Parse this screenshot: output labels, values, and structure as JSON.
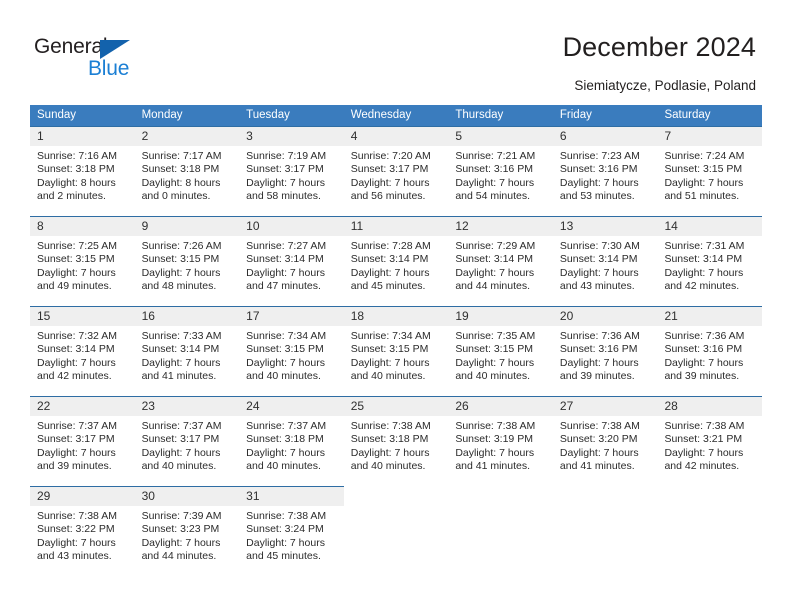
{
  "logo": {
    "word_top": "General",
    "word_bottom": "Blue",
    "triangle_color": "#1362ac",
    "blue_text_color": "#1b7fd4"
  },
  "header": {
    "title": "December 2024",
    "subtitle": "Siemiatycze, Podlasie, Poland"
  },
  "theme": {
    "header_blue": "#3a7cbe",
    "cell_top_border": "#2e6da4",
    "daynum_bg": "#efefef"
  },
  "weekdays": [
    "Sunday",
    "Monday",
    "Tuesday",
    "Wednesday",
    "Thursday",
    "Friday",
    "Saturday"
  ],
  "weeks": [
    [
      {
        "day": "1",
        "sunrise": "Sunrise: 7:16 AM",
        "sunset": "Sunset: 3:18 PM",
        "daylight1": "Daylight: 8 hours",
        "daylight2": "and 2 minutes."
      },
      {
        "day": "2",
        "sunrise": "Sunrise: 7:17 AM",
        "sunset": "Sunset: 3:18 PM",
        "daylight1": "Daylight: 8 hours",
        "daylight2": "and 0 minutes."
      },
      {
        "day": "3",
        "sunrise": "Sunrise: 7:19 AM",
        "sunset": "Sunset: 3:17 PM",
        "daylight1": "Daylight: 7 hours",
        "daylight2": "and 58 minutes."
      },
      {
        "day": "4",
        "sunrise": "Sunrise: 7:20 AM",
        "sunset": "Sunset: 3:17 PM",
        "daylight1": "Daylight: 7 hours",
        "daylight2": "and 56 minutes."
      },
      {
        "day": "5",
        "sunrise": "Sunrise: 7:21 AM",
        "sunset": "Sunset: 3:16 PM",
        "daylight1": "Daylight: 7 hours",
        "daylight2": "and 54 minutes."
      },
      {
        "day": "6",
        "sunrise": "Sunrise: 7:23 AM",
        "sunset": "Sunset: 3:16 PM",
        "daylight1": "Daylight: 7 hours",
        "daylight2": "and 53 minutes."
      },
      {
        "day": "7",
        "sunrise": "Sunrise: 7:24 AM",
        "sunset": "Sunset: 3:15 PM",
        "daylight1": "Daylight: 7 hours",
        "daylight2": "and 51 minutes."
      }
    ],
    [
      {
        "day": "8",
        "sunrise": "Sunrise: 7:25 AM",
        "sunset": "Sunset: 3:15 PM",
        "daylight1": "Daylight: 7 hours",
        "daylight2": "and 49 minutes."
      },
      {
        "day": "9",
        "sunrise": "Sunrise: 7:26 AM",
        "sunset": "Sunset: 3:15 PM",
        "daylight1": "Daylight: 7 hours",
        "daylight2": "and 48 minutes."
      },
      {
        "day": "10",
        "sunrise": "Sunrise: 7:27 AM",
        "sunset": "Sunset: 3:14 PM",
        "daylight1": "Daylight: 7 hours",
        "daylight2": "and 47 minutes."
      },
      {
        "day": "11",
        "sunrise": "Sunrise: 7:28 AM",
        "sunset": "Sunset: 3:14 PM",
        "daylight1": "Daylight: 7 hours",
        "daylight2": "and 45 minutes."
      },
      {
        "day": "12",
        "sunrise": "Sunrise: 7:29 AM",
        "sunset": "Sunset: 3:14 PM",
        "daylight1": "Daylight: 7 hours",
        "daylight2": "and 44 minutes."
      },
      {
        "day": "13",
        "sunrise": "Sunrise: 7:30 AM",
        "sunset": "Sunset: 3:14 PM",
        "daylight1": "Daylight: 7 hours",
        "daylight2": "and 43 minutes."
      },
      {
        "day": "14",
        "sunrise": "Sunrise: 7:31 AM",
        "sunset": "Sunset: 3:14 PM",
        "daylight1": "Daylight: 7 hours",
        "daylight2": "and 42 minutes."
      }
    ],
    [
      {
        "day": "15",
        "sunrise": "Sunrise: 7:32 AM",
        "sunset": "Sunset: 3:14 PM",
        "daylight1": "Daylight: 7 hours",
        "daylight2": "and 42 minutes."
      },
      {
        "day": "16",
        "sunrise": "Sunrise: 7:33 AM",
        "sunset": "Sunset: 3:14 PM",
        "daylight1": "Daylight: 7 hours",
        "daylight2": "and 41 minutes."
      },
      {
        "day": "17",
        "sunrise": "Sunrise: 7:34 AM",
        "sunset": "Sunset: 3:15 PM",
        "daylight1": "Daylight: 7 hours",
        "daylight2": "and 40 minutes."
      },
      {
        "day": "18",
        "sunrise": "Sunrise: 7:34 AM",
        "sunset": "Sunset: 3:15 PM",
        "daylight1": "Daylight: 7 hours",
        "daylight2": "and 40 minutes."
      },
      {
        "day": "19",
        "sunrise": "Sunrise: 7:35 AM",
        "sunset": "Sunset: 3:15 PM",
        "daylight1": "Daylight: 7 hours",
        "daylight2": "and 40 minutes."
      },
      {
        "day": "20",
        "sunrise": "Sunrise: 7:36 AM",
        "sunset": "Sunset: 3:16 PM",
        "daylight1": "Daylight: 7 hours",
        "daylight2": "and 39 minutes."
      },
      {
        "day": "21",
        "sunrise": "Sunrise: 7:36 AM",
        "sunset": "Sunset: 3:16 PM",
        "daylight1": "Daylight: 7 hours",
        "daylight2": "and 39 minutes."
      }
    ],
    [
      {
        "day": "22",
        "sunrise": "Sunrise: 7:37 AM",
        "sunset": "Sunset: 3:17 PM",
        "daylight1": "Daylight: 7 hours",
        "daylight2": "and 39 minutes."
      },
      {
        "day": "23",
        "sunrise": "Sunrise: 7:37 AM",
        "sunset": "Sunset: 3:17 PM",
        "daylight1": "Daylight: 7 hours",
        "daylight2": "and 40 minutes."
      },
      {
        "day": "24",
        "sunrise": "Sunrise: 7:37 AM",
        "sunset": "Sunset: 3:18 PM",
        "daylight1": "Daylight: 7 hours",
        "daylight2": "and 40 minutes."
      },
      {
        "day": "25",
        "sunrise": "Sunrise: 7:38 AM",
        "sunset": "Sunset: 3:18 PM",
        "daylight1": "Daylight: 7 hours",
        "daylight2": "and 40 minutes."
      },
      {
        "day": "26",
        "sunrise": "Sunrise: 7:38 AM",
        "sunset": "Sunset: 3:19 PM",
        "daylight1": "Daylight: 7 hours",
        "daylight2": "and 41 minutes."
      },
      {
        "day": "27",
        "sunrise": "Sunrise: 7:38 AM",
        "sunset": "Sunset: 3:20 PM",
        "daylight1": "Daylight: 7 hours",
        "daylight2": "and 41 minutes."
      },
      {
        "day": "28",
        "sunrise": "Sunrise: 7:38 AM",
        "sunset": "Sunset: 3:21 PM",
        "daylight1": "Daylight: 7 hours",
        "daylight2": "and 42 minutes."
      }
    ],
    [
      {
        "day": "29",
        "sunrise": "Sunrise: 7:38 AM",
        "sunset": "Sunset: 3:22 PM",
        "daylight1": "Daylight: 7 hours",
        "daylight2": "and 43 minutes."
      },
      {
        "day": "30",
        "sunrise": "Sunrise: 7:39 AM",
        "sunset": "Sunset: 3:23 PM",
        "daylight1": "Daylight: 7 hours",
        "daylight2": "and 44 minutes."
      },
      {
        "day": "31",
        "sunrise": "Sunrise: 7:38 AM",
        "sunset": "Sunset: 3:24 PM",
        "daylight1": "Daylight: 7 hours",
        "daylight2": "and 45 minutes."
      },
      {
        "day": "",
        "sunrise": "",
        "sunset": "",
        "daylight1": "",
        "daylight2": ""
      },
      {
        "day": "",
        "sunrise": "",
        "sunset": "",
        "daylight1": "",
        "daylight2": ""
      },
      {
        "day": "",
        "sunrise": "",
        "sunset": "",
        "daylight1": "",
        "daylight2": ""
      },
      {
        "day": "",
        "sunrise": "",
        "sunset": "",
        "daylight1": "",
        "daylight2": ""
      }
    ]
  ]
}
